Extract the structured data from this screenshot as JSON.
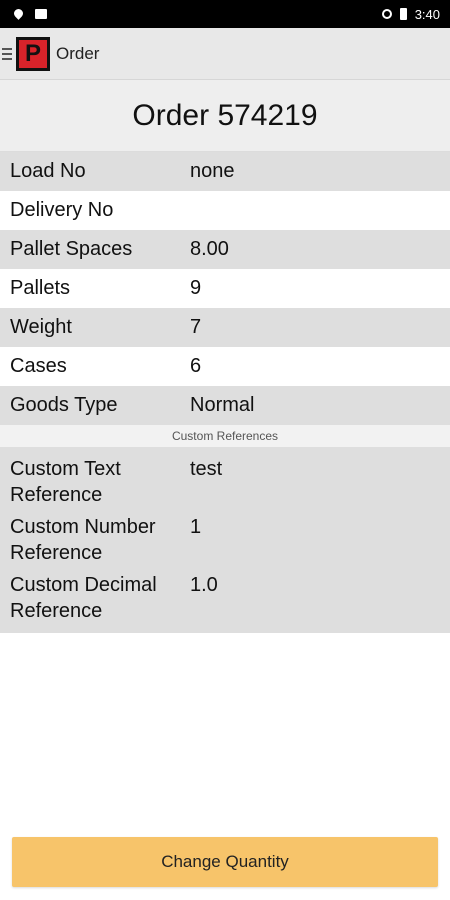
{
  "status_bar": {
    "time": "3:40",
    "icons": [
      "location-pin-icon",
      "image-icon",
      "alarm-icon",
      "battery-icon"
    ]
  },
  "app_bar": {
    "title": "Order",
    "logo_letter": "P",
    "logo_color": "#d8232a"
  },
  "order": {
    "title": "Order 574219"
  },
  "fields": [
    {
      "label": "Load No",
      "value": "none"
    },
    {
      "label": "Delivery No",
      "value": ""
    },
    {
      "label": "Pallet Spaces",
      "value": "8.00"
    },
    {
      "label": "Pallets",
      "value": "9"
    },
    {
      "label": "Weight",
      "value": "7"
    },
    {
      "label": "Cases",
      "value": "6"
    },
    {
      "label": "Goods Type",
      "value": "Normal"
    }
  ],
  "custom_section": {
    "heading": "Custom References",
    "items": [
      {
        "label": "Custom Text Reference",
        "value": "test"
      },
      {
        "label": "Custom Number Reference",
        "value": "1"
      },
      {
        "label": "Custom Decimal Reference",
        "value": "1.0"
      }
    ]
  },
  "actions": {
    "change_quantity_label": "Change Quantity",
    "button_color": "#f7c46a"
  }
}
